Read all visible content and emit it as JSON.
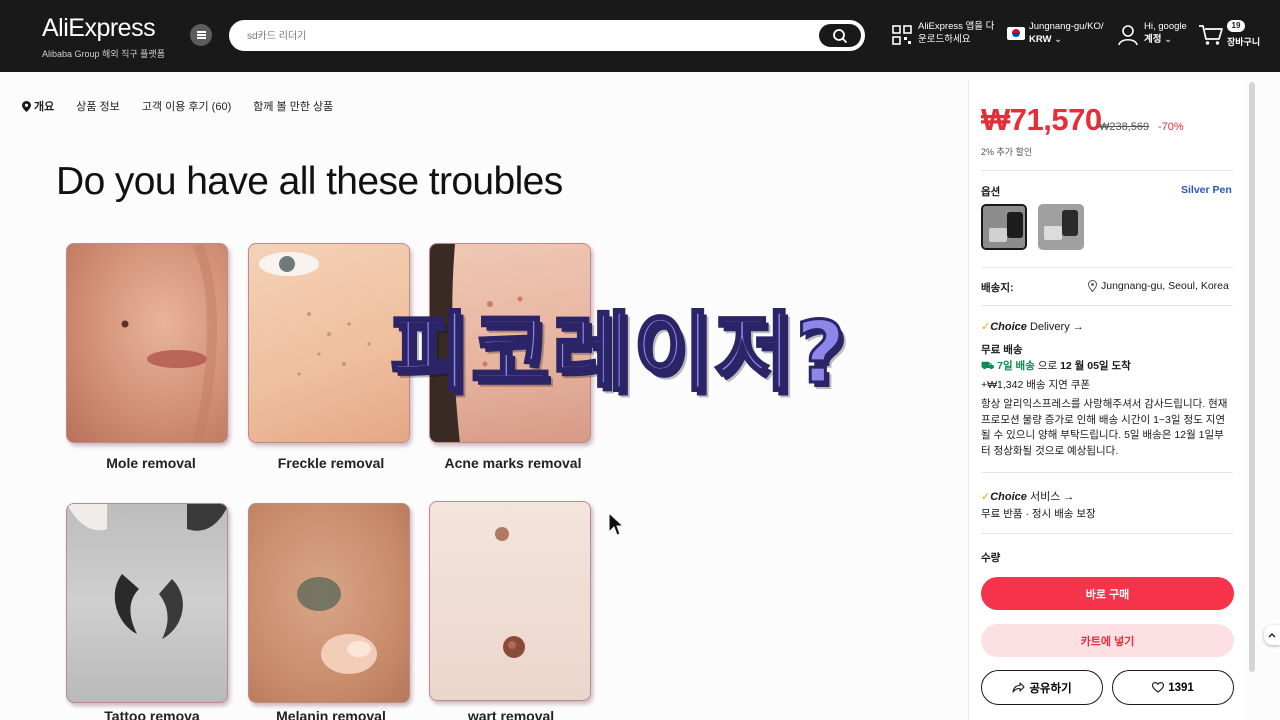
{
  "header": {
    "logo": "AliExpress",
    "logo_sub": "Alibaba Group 해외 직구 플랫폼",
    "search_placeholder": "sd카드 리더기",
    "app_download_line1": "AliExpress 앱을 다",
    "app_download_line2": "운로드하세요",
    "locale_line1": "Jungnang-gu/KO/",
    "locale_line2": "KRW",
    "account_line1": "Hi, google",
    "account_line2": "계정",
    "cart_count": "19",
    "cart_label": "장바구니",
    "icons": [
      "menu-icon",
      "search-icon",
      "qr-icon",
      "korea-flag-icon",
      "user-icon",
      "cart-icon"
    ]
  },
  "subnav": {
    "items": [
      "개요",
      "상품 정보",
      "고객 이용 후기 (60)",
      "함께 볼 만한 상품"
    ]
  },
  "product_image": {
    "headline": "Do you have all these troubles",
    "tiles": [
      "Mole removal",
      "Freckle removal",
      "Acne marks removal",
      "Tattoo remova",
      "Melanin removal",
      "wart removal"
    ],
    "overlay": "피코레이저?"
  },
  "panel": {
    "price": "₩71,570",
    "original_price": "₩238,569",
    "discount": "-70%",
    "extra_discount": "2% 추가 할인",
    "option_label": "옵션",
    "option_selected": "Silver Pen",
    "ship_label": "배송지:",
    "ship_location": "Jungnang-gu, Seoul, Korea",
    "choice_delivery_brand": "Choice",
    "choice_delivery_suffix": "Delivery →",
    "free_shipping": "무료 배송",
    "delivery_days": "7일 배송",
    "delivery_mid": "으로",
    "delivery_date": "12 월 05일 도착",
    "delay_coupon": "+₩1,342 배송 지연 쿠폰",
    "notice": "항상 알리익스프레스를 사랑해주셔서 감사드립니다. 현재 프로모션 물량 증가로 인해 배송 시간이 1~3일 정도 지연될 수 있으니 양해 부탁드립니다. 5일 배송은 12월 1일부터 정상화될 것으로 예상됩니다.",
    "choice_service_brand": "Choice",
    "choice_service_suffix": "서비스 →",
    "service_items": "무료 반품 · 정시 배송 보장",
    "quantity_label": "수량",
    "buy_now": "바로 구매",
    "add_to_cart": "카트에 넣기",
    "share": "공유하기",
    "wishlist_count": "1391",
    "colors": {
      "accent": "#e62e3a",
      "buy_bg": "#f5334a",
      "cart_bg": "#fde0e4",
      "green": "#0b8a55",
      "blue": "#2756b6"
    }
  }
}
